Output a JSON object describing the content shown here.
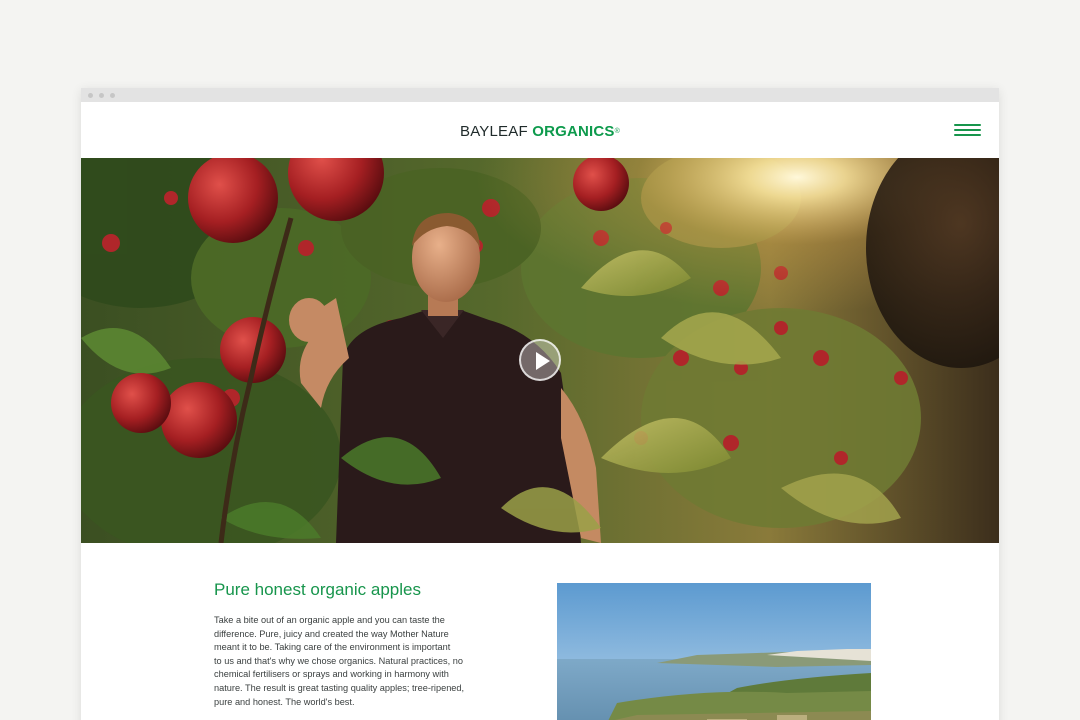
{
  "header": {
    "logo_word1": "BAYLEAF",
    "logo_word2": "ORGANICS",
    "logo_mark": "®",
    "menu_icon": "hamburger-icon"
  },
  "hero": {
    "image_subject": "man-in-apple-orchard",
    "play_icon": "play-icon"
  },
  "intro": {
    "title": "Pure honest organic apples",
    "body_lines": [
      "Take a bite out of an organic apple and you can taste the",
      "difference. Pure, juicy and created the way Mother Nature",
      "meant it to be. Taking care of the environment is important",
      "to us and that's why we chose organics. Natural practices, no",
      "chemical fertilisers or sprays and working in harmony with",
      "nature. The result is great tasting quality apples; tree-ripened,",
      "pure and honest. The world's best."
    ],
    "image_subject": "aerial-coastline"
  },
  "colors": {
    "brand_green": "#17954c",
    "page_bg": "#f4f4f2",
    "text_dark": "#3a3f3f"
  }
}
